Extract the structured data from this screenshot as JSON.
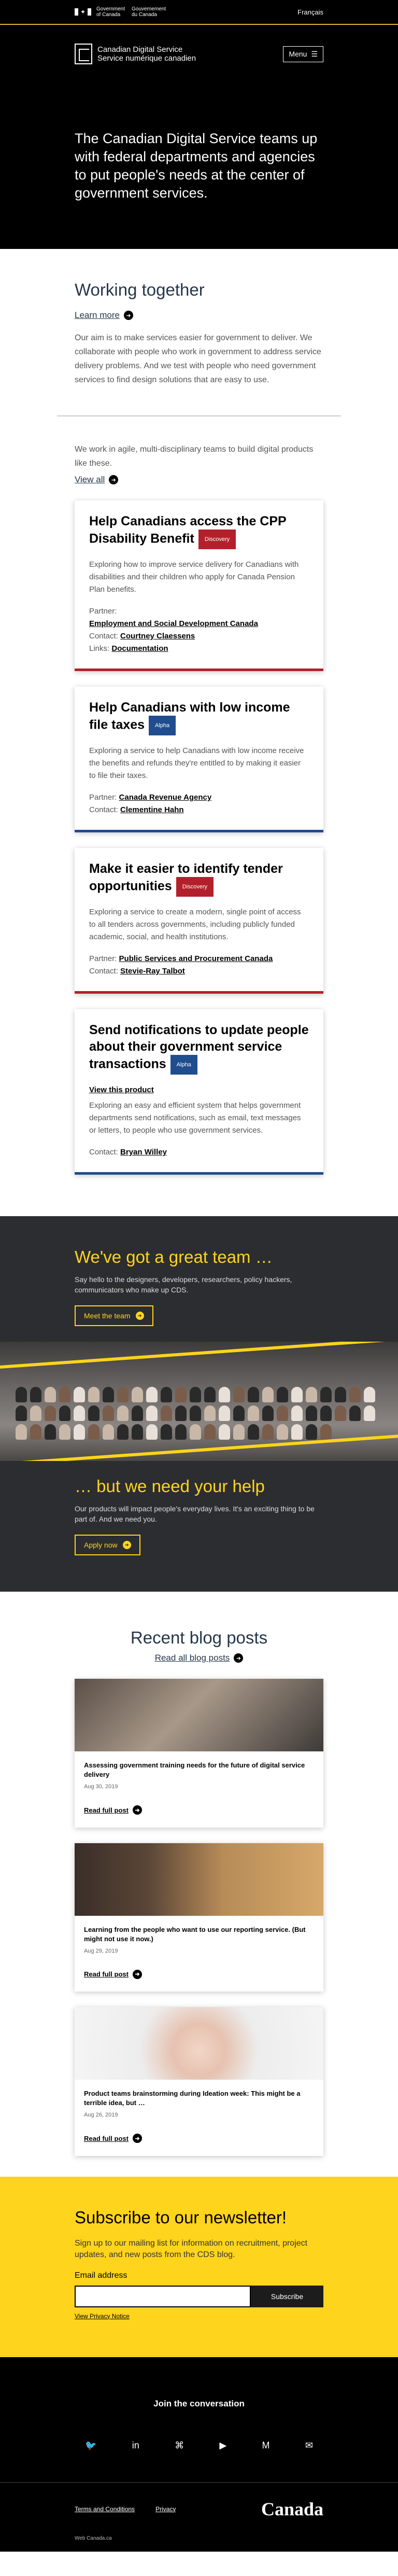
{
  "topbar": {
    "gov_en": "Government of Canada",
    "gov_fr": "Gouvernement du Canada",
    "lang": "Français"
  },
  "header": {
    "logo_en": "Canadian Digital Service",
    "logo_fr": "Service numérique canadien",
    "menu": "Menu"
  },
  "hero": {
    "text": "The Canadian Digital Service teams up with federal departments and agencies to put people's needs at the center of government services."
  },
  "working": {
    "title": "Working together",
    "learn": "Learn more",
    "body": "Our aim is to make services easier for government to deliver. We collaborate with people who work in government to address service delivery problems. And we test with people who need government services to find design solutions that are easy to use."
  },
  "products": {
    "intro": "We work in agile, multi-disciplinary teams to build digital products like these.",
    "view_all": "View all",
    "cards": [
      {
        "title": "Help Canadians access the CPP Disability Benefit",
        "badge": "Discovery",
        "desc": "Exploring how to improve service delivery for Canadians with disabilities and their children who apply for Canada Pension Plan benefits.",
        "partner_label": "Partner:",
        "partner": "Employment and Social Development Canada",
        "contact_label": "Contact:",
        "contact": "Courtney Claessens",
        "links_label": "Links:",
        "links": "Documentation"
      },
      {
        "title": "Help Canadians with low income file taxes",
        "badge": "Alpha",
        "desc": "Exploring a service to help Canadians with low income receive the benefits and refunds they're entitled to by making it easier to file their taxes.",
        "partner_label": "Partner:",
        "partner": "Canada Revenue Agency",
        "contact_label": "Contact:",
        "contact": "Clementine Hahn"
      },
      {
        "title": "Make it easier to identify tender opportunities",
        "badge": "Discovery",
        "desc": "Exploring a service to create a modern, single point of access to all tenders across governments, including publicly funded academic, social, and health institutions.",
        "partner_label": "Partner:",
        "partner": "Public Services and Procurement Canada",
        "contact_label": "Contact:",
        "contact": "Stevie-Ray Talbot"
      },
      {
        "title": "Send notifications to update people about their government service transactions",
        "badge": "Alpha",
        "view_product": "View this product",
        "desc": "Exploring an easy and efficient system that helps government departments send notifications, such as email, text messages or letters, to people who use government services.",
        "contact_label": "Contact:",
        "contact": "Bryan Willey"
      }
    ]
  },
  "team": {
    "title": "We've got a great team …",
    "body": "Say hello to the designers, developers, researchers, policy hackers, communicators who make up CDS.",
    "meet": "Meet the team",
    "title2": "… but we need your help",
    "body2": "Our products will impact people's everyday lives. It's an exciting thing to be part of. And we need you.",
    "apply": "Apply now"
  },
  "blog": {
    "title": "Recent blog posts",
    "read_all": "Read all blog posts",
    "posts": [
      {
        "title": "Assessing government training needs for the future of digital service delivery",
        "date": "Aug 30, 2019",
        "read": "Read full post"
      },
      {
        "title": "Learning from the people who want to use our reporting service. (But might not use it now.)",
        "date": "Aug 29, 2019",
        "read": "Read full post"
      },
      {
        "title": "Product teams brainstorming during Ideation week: This might be a terrible idea, but …",
        "date": "Aug 26, 2019",
        "read": "Read full post"
      }
    ]
  },
  "newsletter": {
    "title": "Subscribe to our newsletter!",
    "body": "Sign up to our mailing list for information on recruitment, project updates, and new posts from the CDS blog.",
    "email_label": "Email address",
    "subscribe": "Subscribe",
    "privacy": "View Privacy Notice"
  },
  "join": {
    "title": "Join the conversation",
    "icons": [
      "twitter-icon",
      "linkedin-icon",
      "github-icon",
      "youtube-icon",
      "medium-icon",
      "email-icon"
    ]
  },
  "footer": {
    "terms": "Terms and Conditions",
    "privacy": "Privacy",
    "wordmark": "Canada",
    "web": "Web Canada.ca"
  },
  "colors": {
    "accent_yellow": "#ffd41c",
    "discovery_red": "#b3202b",
    "alpha_blue": "#1f4d8e",
    "navy": "#26374a"
  }
}
